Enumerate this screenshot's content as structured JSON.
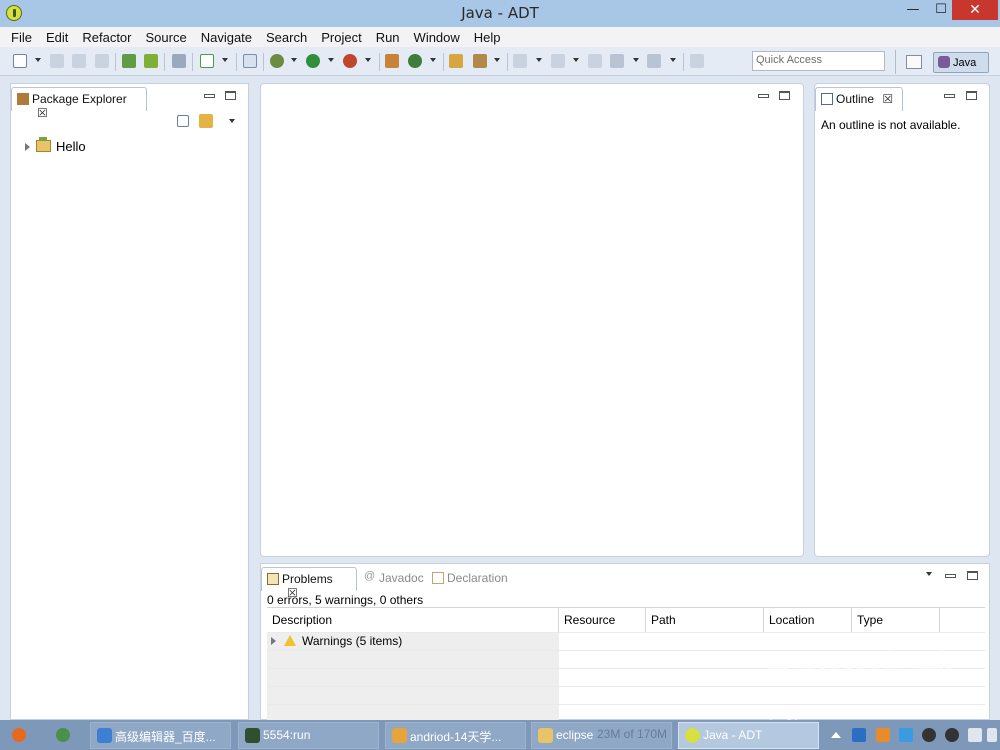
{
  "window": {
    "title": "Java - ADT",
    "min": "—",
    "max": "☐",
    "close": "✕"
  },
  "menu": [
    "File",
    "Edit",
    "Refactor",
    "Source",
    "Navigate",
    "Search",
    "Project",
    "Run",
    "Window",
    "Help"
  ],
  "toolbar": {
    "quick_access_placeholder": "Quick Access",
    "perspective": "Java"
  },
  "package_explorer": {
    "tab": "Package Explorer",
    "project": "Hello"
  },
  "outline": {
    "tab": "Outline",
    "message": "An outline is not available."
  },
  "problems": {
    "tabs": [
      "Problems",
      "Javadoc",
      "Declaration"
    ],
    "summary": "0 errors, 5 warnings, 0 others",
    "columns": [
      "Description",
      "Resource",
      "Path",
      "Location",
      "Type"
    ],
    "rows": [
      {
        "description": "Warnings (5 items)"
      }
    ]
  },
  "taskbar": {
    "buttons": [
      "高级编辑器_百度...",
      "5554:run",
      "andriod-14天学...",
      "eclipse",
      "Java - ADT"
    ],
    "heap": "23M of 170M"
  },
  "watermark": {
    "brand": "Baidu经验",
    "url": "jingyan.baidu.com"
  },
  "colors": {
    "close": "#c8372d",
    "titlebar": "#a8c6e6",
    "workbench": "#dde6f1",
    "warning": "#f1c22e"
  }
}
